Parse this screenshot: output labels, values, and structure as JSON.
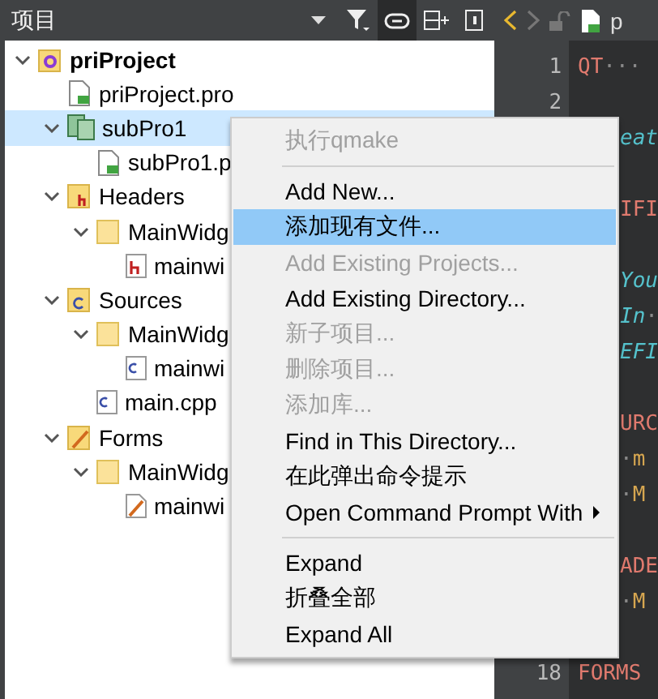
{
  "projects_panel": {
    "title": "项目"
  },
  "tree": [
    {
      "label": "priProject",
      "kind": "project",
      "expanded": true,
      "selected": false,
      "children": [
        {
          "label": "priProject.pro",
          "kind": "pro",
          "selected": false
        },
        {
          "label": "subPro1",
          "kind": "subproject",
          "expanded": true,
          "selected": true,
          "children": [
            {
              "label": "subPro1.p",
              "kind": "pro",
              "selected": false
            }
          ]
        },
        {
          "label": "Headers",
          "kind": "headers",
          "expanded": true,
          "selected": false,
          "children": [
            {
              "label": "MainWidg",
              "kind": "folder",
              "expanded": true,
              "selected": false,
              "children": [
                {
                  "label": "mainwi",
                  "kind": "header",
                  "selected": false
                }
              ]
            }
          ]
        },
        {
          "label": "Sources",
          "kind": "sources",
          "expanded": true,
          "selected": false,
          "children": [
            {
              "label": "MainWidg",
              "kind": "folder",
              "expanded": true,
              "selected": false,
              "children": [
                {
                  "label": "mainwi",
                  "kind": "source",
                  "selected": false
                }
              ]
            },
            {
              "label": "main.cpp",
              "kind": "source",
              "selected": false
            }
          ]
        },
        {
          "label": "Forms",
          "kind": "forms",
          "expanded": true,
          "selected": false,
          "children": [
            {
              "label": "MainWidg",
              "kind": "folder",
              "expanded": true,
              "selected": false,
              "children": [
                {
                  "label": "mainwi",
                  "kind": "form",
                  "selected": false
                }
              ]
            }
          ]
        }
      ]
    }
  ],
  "editor": {
    "tab_title": "p",
    "lines": [
      {
        "kind": "code",
        "number": "1",
        "segments": [
          {
            "text": "QT",
            "kind": "keyword"
          },
          {
            "text": "···",
            "kind": "space"
          }
        ]
      },
      {
        "kind": "code",
        "number": "2"
      },
      {
        "kind": "code",
        "segments": [
          {
            "text": "eat",
            "kind": "comment"
          }
        ]
      },
      {
        "kind": "blank"
      },
      {
        "kind": "code",
        "segments": [
          {
            "text": "IFI",
            "kind": "keyword"
          }
        ]
      },
      {
        "kind": "blank"
      },
      {
        "kind": "code",
        "segments": [
          {
            "text": "You",
            "kind": "comment"
          }
        ]
      },
      {
        "kind": "code",
        "segments": [
          {
            "text": "In",
            "kind": "comment"
          },
          {
            "text": "·",
            "kind": "space"
          }
        ]
      },
      {
        "kind": "code",
        "segments": [
          {
            "text": "EFI",
            "kind": "comment"
          }
        ]
      },
      {
        "kind": "blank"
      },
      {
        "kind": "code",
        "segments": [
          {
            "text": "URC",
            "kind": "keyword"
          }
        ]
      },
      {
        "kind": "code",
        "segments": [
          {
            "text": "·",
            "kind": "space"
          },
          {
            "text": "m",
            "kind": "value"
          }
        ]
      },
      {
        "kind": "code",
        "segments": [
          {
            "text": "·",
            "kind": "space"
          },
          {
            "text": "M",
            "kind": "value"
          }
        ]
      },
      {
        "kind": "blank"
      },
      {
        "kind": "code",
        "segments": [
          {
            "text": "ADE",
            "kind": "keyword"
          }
        ]
      },
      {
        "kind": "code",
        "segments": [
          {
            "text": "·",
            "kind": "space"
          },
          {
            "text": "M",
            "kind": "value"
          }
        ]
      },
      {
        "kind": "blank"
      },
      {
        "kind": "code",
        "number": "18",
        "segments": [
          {
            "text": "FORMS",
            "kind": "keyword"
          }
        ]
      }
    ]
  },
  "context_menu": [
    {
      "kind": "item",
      "label": "执行qmake",
      "disabled": true,
      "selected": false
    },
    {
      "kind": "separator"
    },
    {
      "kind": "item",
      "label": "Add New...",
      "disabled": false,
      "selected": false
    },
    {
      "kind": "item",
      "label": "添加现有文件...",
      "disabled": false,
      "selected": true
    },
    {
      "kind": "item",
      "label": "Add Existing Projects...",
      "disabled": true,
      "selected": false
    },
    {
      "kind": "item",
      "label": "Add Existing Directory...",
      "disabled": false,
      "selected": false
    },
    {
      "kind": "item",
      "label": "新子项目...",
      "disabled": true,
      "selected": false
    },
    {
      "kind": "item",
      "label": "删除项目...",
      "disabled": true,
      "selected": false
    },
    {
      "kind": "item",
      "label": "添加库...",
      "disabled": true,
      "selected": false
    },
    {
      "kind": "item",
      "label": "Find in This Directory...",
      "disabled": false,
      "selected": false
    },
    {
      "kind": "item",
      "label": "在此弹出命令提示",
      "disabled": false,
      "selected": false
    },
    {
      "kind": "submenu",
      "label": "Open Command Prompt With",
      "disabled": false,
      "selected": false
    },
    {
      "kind": "separator"
    },
    {
      "kind": "item",
      "label": "Expand",
      "disabled": false,
      "selected": false
    },
    {
      "kind": "item",
      "label": "折叠全部",
      "disabled": false,
      "selected": false
    },
    {
      "kind": "item",
      "label": "Expand All",
      "disabled": false,
      "selected": false
    }
  ]
}
